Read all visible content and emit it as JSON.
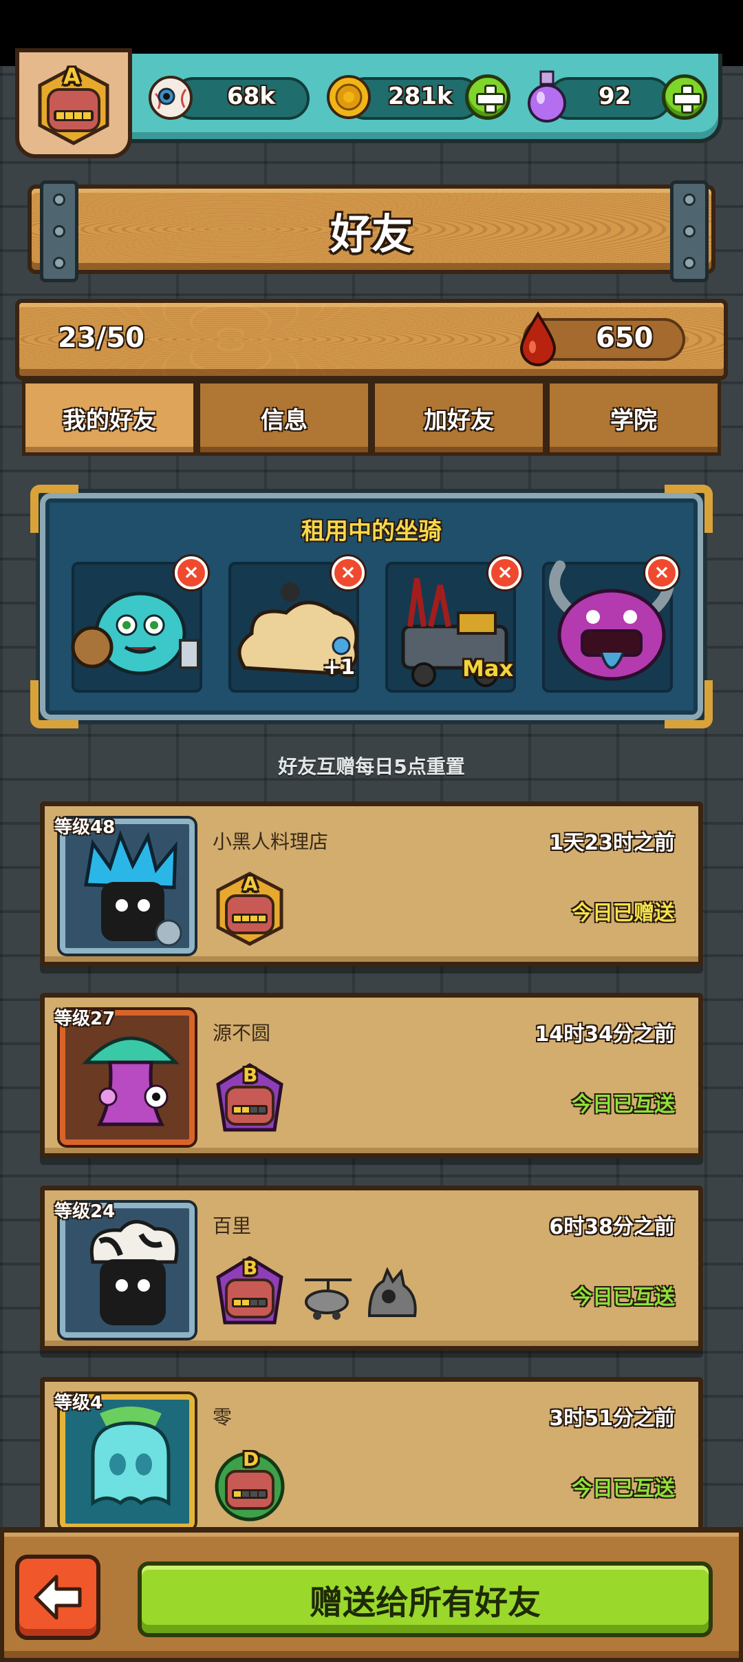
{
  "header": {
    "player_rank": "A",
    "eyes": "68k",
    "coins": "281k",
    "potions": "92"
  },
  "title": "好友",
  "stats": {
    "friend_count": "23/50",
    "blood_points": "650"
  },
  "tabs": [
    {
      "label": "我的好友",
      "active": true
    },
    {
      "label": "信息",
      "active": false
    },
    {
      "label": "加好友",
      "active": false
    },
    {
      "label": "学院",
      "active": false
    }
  ],
  "mounts": {
    "title": "租用中的坐骑",
    "items": [
      {
        "name": "teal-knight-mount",
        "badge": ""
      },
      {
        "name": "cloud-mount",
        "badge": "+1"
      },
      {
        "name": "machine-mount",
        "badge": "Max"
      },
      {
        "name": "purple-horned-mount",
        "badge": ""
      }
    ]
  },
  "reset_note": "好友互赠每日5点重置",
  "friends": [
    {
      "level": "等级48",
      "name": "小黑人料理店",
      "last_seen": "1天23时之前",
      "status": "今日已赠送",
      "rank": "A",
      "status_color": "#f4e24a"
    },
    {
      "level": "等级27",
      "name": "源不圆",
      "last_seen": "14时34分之前",
      "status": "今日已互送",
      "rank": "B",
      "status_color": "#8ee23a"
    },
    {
      "level": "等级24",
      "name": "百里",
      "last_seen": "6时38分之前",
      "status": "今日已互送",
      "rank": "B",
      "status_color": "#8ee23a"
    },
    {
      "level": "等级4",
      "name": "零",
      "last_seen": "3时51分之前",
      "status": "今日已互送",
      "rank": "D",
      "status_color": "#8ee23a"
    }
  ],
  "bottom": {
    "send_all_label": "赠送给所有好友"
  },
  "colors": {
    "accent_green": "#9ad82c",
    "wood": "#d4994b",
    "panel_blue": "#1f4f6a"
  }
}
